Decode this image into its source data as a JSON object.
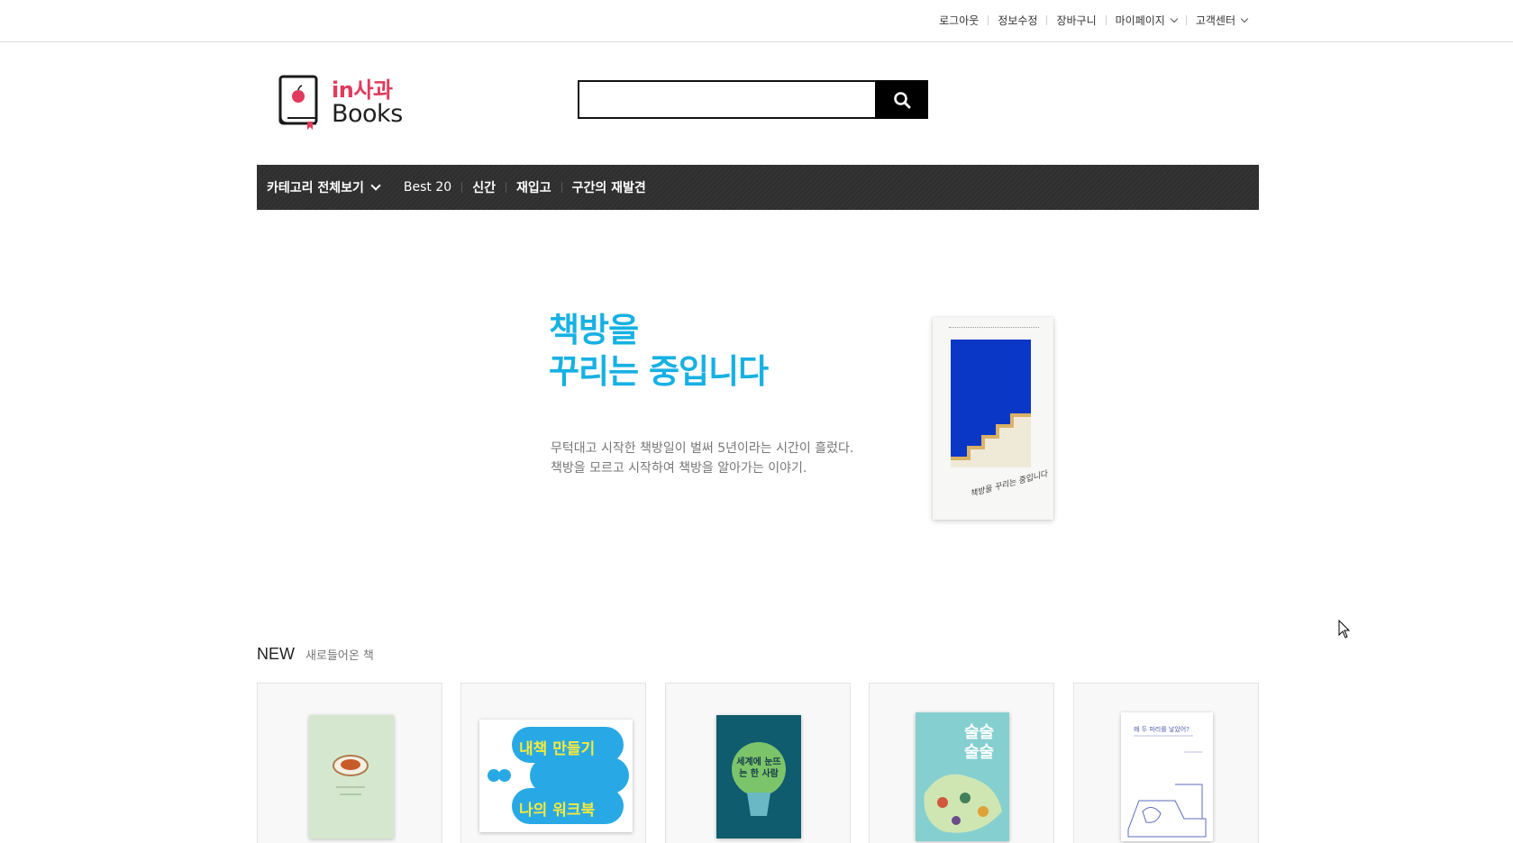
{
  "top_menu": {
    "logout": "로그아웃",
    "edit_info": "정보수정",
    "cart": "장바구니",
    "mypage": "마이페이지",
    "support": "고객센터"
  },
  "logo": {
    "line1": "in사과",
    "line2": "Books"
  },
  "search": {
    "value": "",
    "icon": "search-icon"
  },
  "gnb": {
    "category_all": "카테고리 전체보기",
    "best": "Best 20",
    "new": "신간",
    "restock": "재입고",
    "rediscover": "구간의 재발견"
  },
  "banner": {
    "title_line1": "책방을",
    "title_line2": "꾸리는 중입니다",
    "sub_line1": "무턱대고 시작한 책방일이 벌써 5년이라는 시간이 흘렀다.",
    "sub_line2": "책방을 모르고 시작하여 책방을 알아가는 이야기.",
    "book_cover_text": "책방을 꾸리는 중입니다",
    "colors": {
      "title": "#17b1e3",
      "art_blue": "#0b37c6",
      "stair": "#d9b265"
    }
  },
  "new_section": {
    "title": "NEW",
    "subtitle": "새로들어온 책",
    "books": [
      {
        "cover_text": "",
        "color": "#d5e8cf"
      },
      {
        "cover_text_1": "내책 만들기",
        "cover_text_2": "나의 워크북",
        "color": "#28a9e5"
      },
      {
        "cover_text": "세계에 눈뜨는 한 사람",
        "color": "#0f5c6e"
      },
      {
        "cover_text": "술술 술술",
        "color": "#86cfd0"
      },
      {
        "cover_text": "왜 두 마리를 낳았어?",
        "color": "#ffffff"
      }
    ]
  }
}
